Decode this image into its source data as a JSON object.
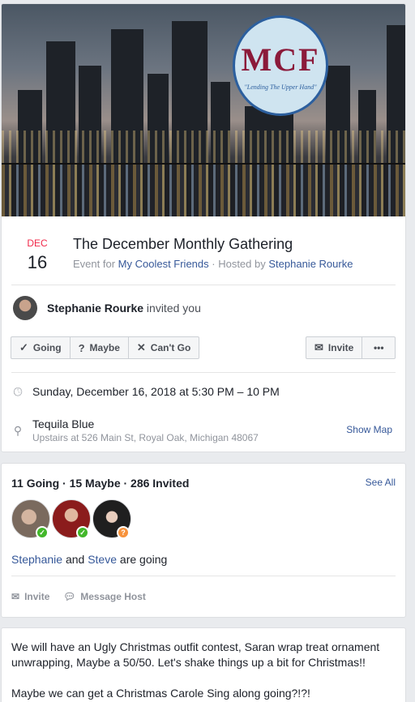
{
  "cover": {
    "logo_letters": "MCF",
    "logo_motto": "\"Lending The Upper Hand\""
  },
  "event": {
    "month": "DEC",
    "day": "16",
    "title": "The December Monthly Gathering",
    "event_for_prefix": "Event for",
    "group_name": "My Coolest Friends",
    "hosted_prefix": "· Hosted by",
    "host_name": "Stephanie Rourke"
  },
  "inviter": {
    "name": "Stephanie Rourke",
    "action": "invited you"
  },
  "rsvp": {
    "going": "Going",
    "maybe": "Maybe",
    "cant_go": "Can't Go",
    "invite": "Invite",
    "more": "•••"
  },
  "details": {
    "datetime": "Sunday, December 16, 2018 at 5:30 PM – 10 PM",
    "venue": "Tequila Blue",
    "address": "Upstairs at 526 Main St, Royal Oak, Michigan 48067",
    "show_map": "Show Map"
  },
  "guests": {
    "stats": "11 Going · 15 Maybe · 286 Invited",
    "see_all": "See All",
    "name1": "Stephanie",
    "and": "and",
    "name2": "Steve",
    "are_going": "are going",
    "invite": "Invite",
    "message_host": "Message Host"
  },
  "description": {
    "para1": "We will have an Ugly Christmas outfit contest, Saran wrap treat ornament unwrapping, Maybe a 50/50. Let's shake things up a bit for Christmas!!",
    "para2": "Maybe we can get a Christmas Carole Sing along going?!?!"
  },
  "colors": {
    "link": "#365899",
    "date_month": "#f02849",
    "going_badge": "#42b72a",
    "maybe_badge": "#f7923b"
  }
}
